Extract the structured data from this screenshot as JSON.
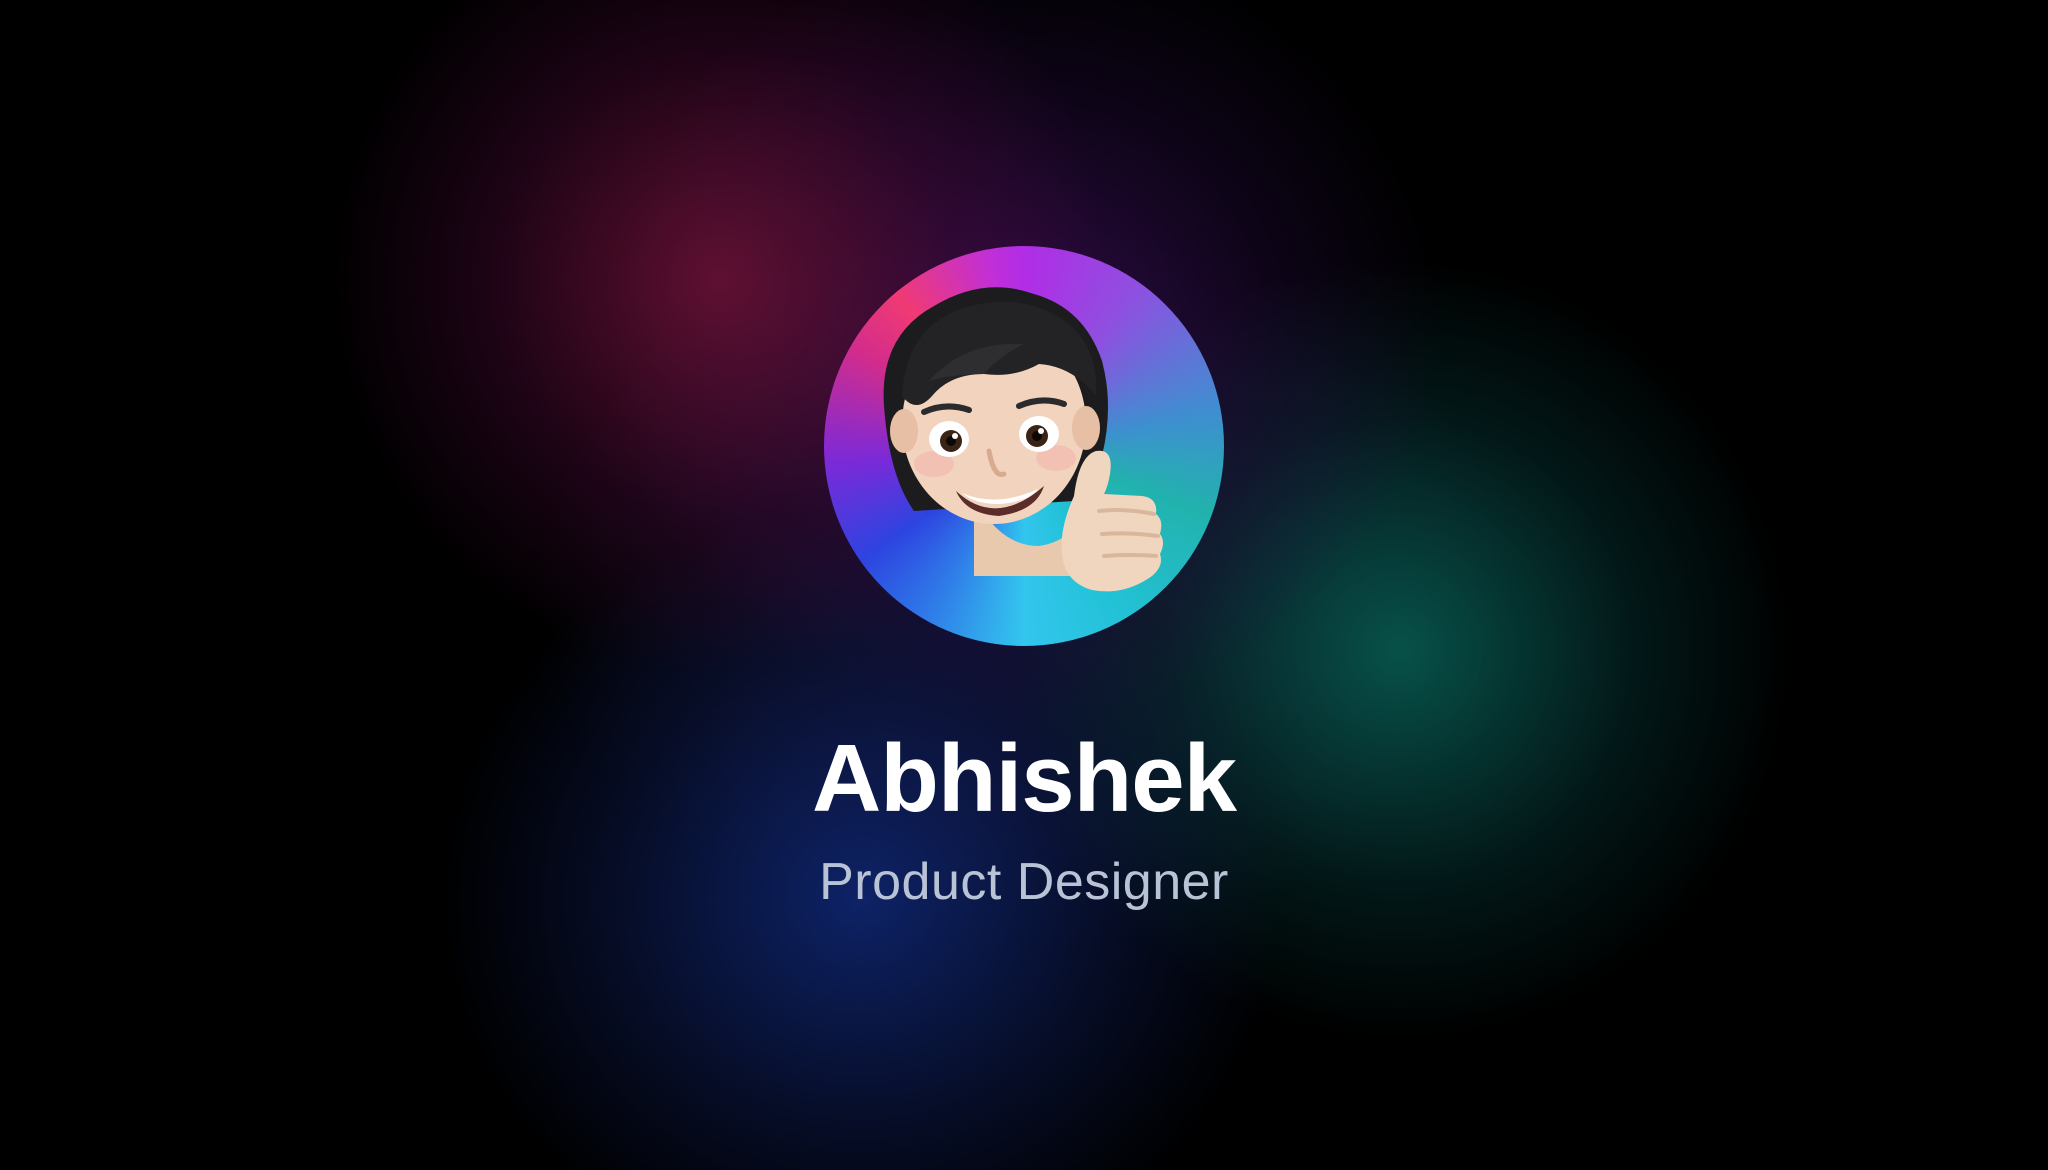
{
  "profile": {
    "name": "Abhishek",
    "role": "Product Designer",
    "avatar_icon": "memoji-thumbs-up-icon"
  },
  "colors": {
    "background": "#000000",
    "name_text": "#ffffff",
    "role_text": "#b9c3d6",
    "ring_magenta": "#b12de6",
    "ring_pink": "#f03a74",
    "ring_blue": "#2d44e0",
    "ring_cyan": "#33c5ee",
    "ring_teal": "#22b2ad"
  }
}
